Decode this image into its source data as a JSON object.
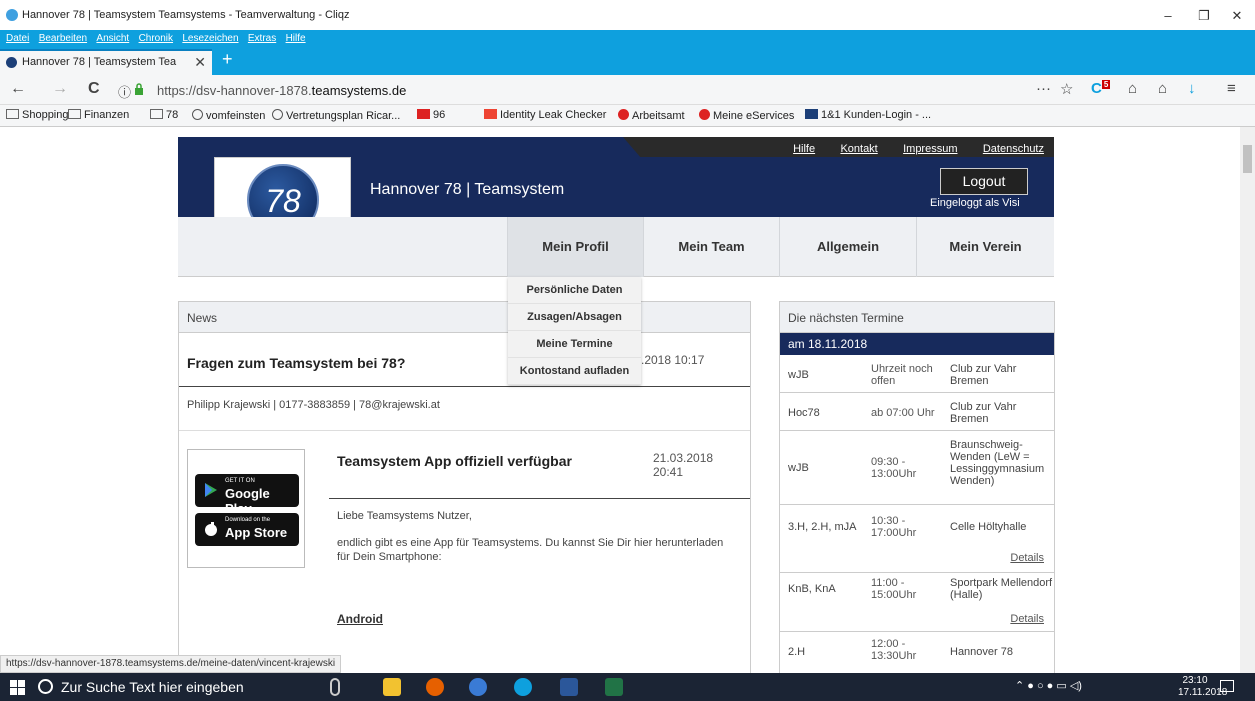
{
  "window": {
    "title": "Hannover 78 | Teamsystem Teamsystems - Teamverwaltung - Cliqz",
    "controls": [
      "–",
      "❐",
      "✕"
    ]
  },
  "menu": [
    "Datei",
    "Bearbeiten",
    "Ansicht",
    "Chronik",
    "Lesezeichen",
    "Extras",
    "Hilfe"
  ],
  "tab": {
    "label": "Hannover 78 | Teamsystem Tea",
    "close": "✕",
    "new": "+"
  },
  "nav": {
    "url_prefix": "https://dsv-hannover-1878.",
    "url_domain": "teamsystems.de",
    "back": "←",
    "forward": "→",
    "reload": "C",
    "info": "ⓘ",
    "overflow": "···",
    "star": "☆",
    "badge": "5"
  },
  "bookmarks": [
    {
      "label": "Shopping",
      "icon": "folder"
    },
    {
      "label": "Finanzen",
      "icon": "folder"
    },
    {
      "label": "78",
      "icon": "folder"
    },
    {
      "label": "vomfeinsten",
      "icon": "globe"
    },
    {
      "label": "Vertretungsplan Ricar...",
      "icon": "globe"
    },
    {
      "label": "96",
      "icon": "site"
    },
    {
      "label": "Identity Leak Checker",
      "icon": "site"
    },
    {
      "label": "Arbeitsamt",
      "icon": "site"
    },
    {
      "label": "Meine eServices",
      "icon": "site"
    },
    {
      "label": "1&1 Kunden-Login - ...",
      "icon": "site"
    }
  ],
  "site": {
    "toplinks": [
      "Hilfe",
      "Kontakt",
      "Impressum",
      "Datenschutz"
    ],
    "logo_text": "78",
    "title": "Hannover 78 | Teamsystem",
    "logout": "Logout",
    "logged_in": "Eingeloggt als Visi",
    "nav": [
      "Mein Profil",
      "Mein Team",
      "Allgemein",
      "Mein Verein"
    ],
    "dropdown": [
      "Persönliche Daten",
      "Zusagen/Absagen",
      "Meine Termine",
      "Kontostand aufladen"
    ]
  },
  "news": {
    "header": "News",
    "item1": {
      "title": "Fragen zum Teamsystem bei 78?",
      "date": ".2018 10:17",
      "body": "Philipp Krajewski | 0177-3883859 | 78@krajewski.at"
    },
    "item2": {
      "title": "Teamsystem App offiziell verfügbar",
      "date": "21.03.2018 20:41",
      "p1": "Liebe Teamsystems Nutzer,",
      "p2": "endlich gibt es eine App für Teamsystems. Du kannst Sie Dir hier herunterladen für Dein Smartphone:",
      "android": "Android"
    },
    "stores": {
      "google_small": "GET IT ON",
      "google_big": "Google Play",
      "apple_small": "Download on the",
      "apple_big": "App Store"
    }
  },
  "termine": {
    "header": "Die nächsten Termine",
    "date": "am 18.11.2018",
    "details_label": "Details",
    "rows": [
      {
        "team": "wJB",
        "time": "Uhrzeit noch offen",
        "place": "Club zur Vahr Bremen"
      },
      {
        "team": "Hoc78",
        "time": "ab 07:00 Uhr",
        "place": "Club zur Vahr Bremen"
      },
      {
        "team": "wJB",
        "time": "09:30 - 13:00Uhr",
        "place": "Braunschweig-Wenden (LeW = Lessinggymnasium Wenden)"
      },
      {
        "team": "3.H, 2.H, mJA",
        "time": "10:30 - 17:00Uhr",
        "place": "Celle Höltyhalle"
      },
      {
        "team": "KnB, KnA",
        "time": "11:00 - 15:00Uhr",
        "place": "Sportpark Mellendorf (Halle)"
      },
      {
        "team": "2.H",
        "time": "12:00 - 13:30Uhr",
        "place": "Hannover 78"
      }
    ]
  },
  "status_url": "https://dsv-hannover-1878.teamsystems.de/meine-daten/vincent-krajewski",
  "taskbar": {
    "search": "Zur Suche Text hier eingeben",
    "time": "23:10",
    "date": "17.11.2018"
  },
  "colors": {
    "browser_accent": "#0ea0de",
    "site_navy": "#172a5c",
    "taskbar": "#1b2434"
  }
}
